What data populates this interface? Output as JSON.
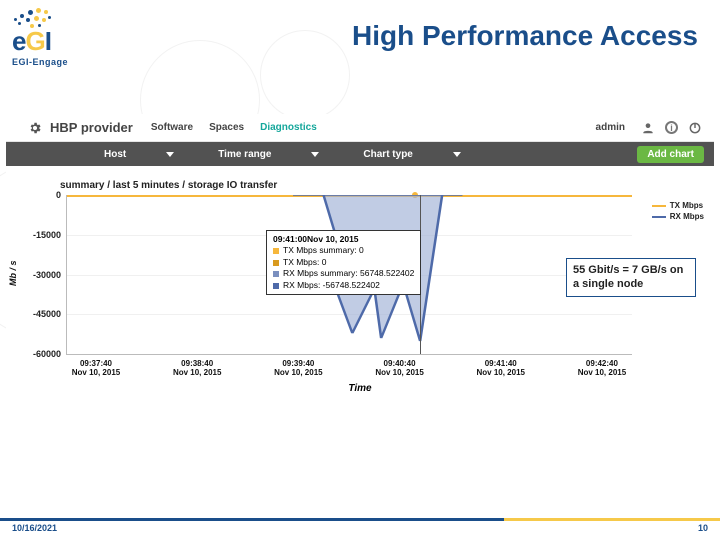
{
  "slide": {
    "title": "High Performance Access",
    "footer_date": "10/16/2021",
    "footer_page": "10",
    "callout": "55 Gbit/s = 7 GB/s on a single node"
  },
  "logo": {
    "word": "eGI",
    "sub": "EGI-Engage"
  },
  "app": {
    "brand": "HBP provider",
    "nav": {
      "software": "Software",
      "spaces": "Spaces",
      "diagnostics": "Diagnostics"
    },
    "admin": "admin",
    "filters": {
      "host": "Host",
      "timerange": "Time range",
      "charttype": "Chart type",
      "addchart": "Add chart"
    },
    "chart": {
      "title": "summary / last 5 minutes / storage IO transfer",
      "ylabel": "Mb / s",
      "xlabel": "Time",
      "legend": {
        "tx": "TX Mbps",
        "rx": "RX Mbps"
      }
    },
    "tooltip": {
      "header": "09:41:00Nov 10, 2015",
      "rows": [
        "TX Mbps summary: 0",
        "TX Mbps: 0",
        "RX Mbps summary: 56748.522402",
        "RX Mbps: -56748.522402"
      ]
    }
  },
  "chart_data": {
    "type": "line",
    "title": "summary / last 5 minutes / storage IO transfer",
    "xlabel": "Time",
    "ylabel": "Mb / s",
    "ylim": [
      -60000,
      0
    ],
    "yticks": [
      0,
      -15000,
      -30000,
      -45000,
      -60000
    ],
    "x": [
      "09:37:40",
      "09:38:40",
      "09:39:40",
      "09:40:40",
      "09:41:40",
      "09:42:40"
    ],
    "x_date": "Nov 10, 2015",
    "series": [
      {
        "name": "TX Mbps",
        "color": "#f6b73c",
        "values": [
          0,
          0,
          0,
          0,
          0,
          0
        ]
      },
      {
        "name": "RX Mbps",
        "color": "#4e6aa9",
        "values": [
          0,
          0,
          0,
          -56749,
          0,
          0
        ]
      }
    ],
    "legend_position": "right"
  }
}
